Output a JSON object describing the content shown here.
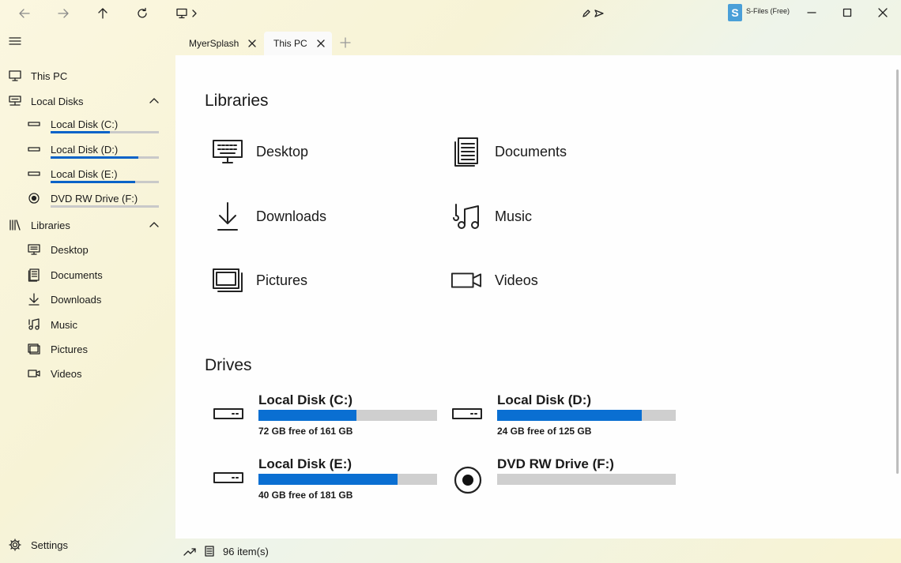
{
  "app": {
    "title": "S-Files (Free)"
  },
  "tabs": [
    {
      "label": "MyerSplash"
    },
    {
      "label": "This PC"
    }
  ],
  "sidebar": {
    "this_pc": "This PC",
    "local_disks": "Local Disks",
    "disks": [
      {
        "label": "Local Disk (C:)",
        "used_fraction": 0.55
      },
      {
        "label": "Local Disk (D:)",
        "used_fraction": 0.81
      },
      {
        "label": "Local Disk (E:)",
        "used_fraction": 0.78
      },
      {
        "label": "DVD RW Drive (F:)",
        "used_fraction": 0.0
      }
    ],
    "libraries": "Libraries",
    "library_items": [
      "Desktop",
      "Documents",
      "Downloads",
      "Music",
      "Pictures",
      "Videos"
    ],
    "settings": "Settings"
  },
  "main": {
    "libraries_title": "Libraries",
    "libraries": [
      {
        "label": "Desktop",
        "icon": "desktop-icon"
      },
      {
        "label": "Documents",
        "icon": "documents-icon"
      },
      {
        "label": "Downloads",
        "icon": "downloads-icon"
      },
      {
        "label": "Music",
        "icon": "music-icon"
      },
      {
        "label": "Pictures",
        "icon": "pictures-icon"
      },
      {
        "label": "Videos",
        "icon": "videos-icon"
      }
    ],
    "drives_title": "Drives",
    "drives": [
      {
        "name": "Local Disk (C:)",
        "free": "72 GB free of 161 GB",
        "used_fraction": 0.55
      },
      {
        "name": "Local Disk (D:)",
        "free": "24 GB free of 125 GB",
        "used_fraction": 0.81
      },
      {
        "name": "Local Disk (E:)",
        "free": "40 GB free of 181 GB",
        "used_fraction": 0.78
      },
      {
        "name": "DVD RW Drive (F:)",
        "free": "",
        "used_fraction": 0.0
      }
    ]
  },
  "status": {
    "items": "96 item(s)"
  },
  "colors": {
    "accent": "#0a6fd2",
    "bar_track": "#cfcfcf"
  }
}
